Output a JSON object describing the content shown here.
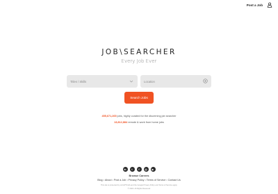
{
  "header": {
    "post_job_label": "Post a Job",
    "user_icon": "user-icon"
  },
  "brand": {
    "logo_text": "JOB\\SEARCHER",
    "tagline": "Every Job Ever"
  },
  "search": {
    "title_placeholder": "Titles / Skills",
    "location_placeholder": "Location",
    "button_label": "Search Jobs"
  },
  "stats": {
    "jobs_count": "455,671,265",
    "jobs_text": "jobs, highly curated for the discerning job searcher",
    "remote_count": "13,812,884",
    "remote_text": "remote & work from home jobs"
  },
  "footer": {
    "socials": [
      {
        "icon": "linkedin-icon",
        "glyph": "in"
      },
      {
        "icon": "twitter-icon",
        "glyph": "t"
      },
      {
        "icon": "facebook-icon",
        "glyph": "f"
      },
      {
        "icon": "instagram-icon",
        "glyph": "◎"
      },
      {
        "icon": "youtube-icon",
        "glyph": "▶"
      }
    ],
    "browse_careers": "Browse Careers",
    "links": [
      "Blog",
      "About",
      "Post a Job",
      "Privacy Policy",
      "Terms of Service",
      "Contact Us"
    ],
    "recaptcha_note": "This site is protected by reCAPTCHA and the Google Privacy Policy and Terms of Service apply.",
    "copyright": "© 2024. All Rights Reserved"
  },
  "colors": {
    "accent": "#f05223",
    "field_bg": "#e8e8e8",
    "social_bg": "#2b2b2b"
  }
}
